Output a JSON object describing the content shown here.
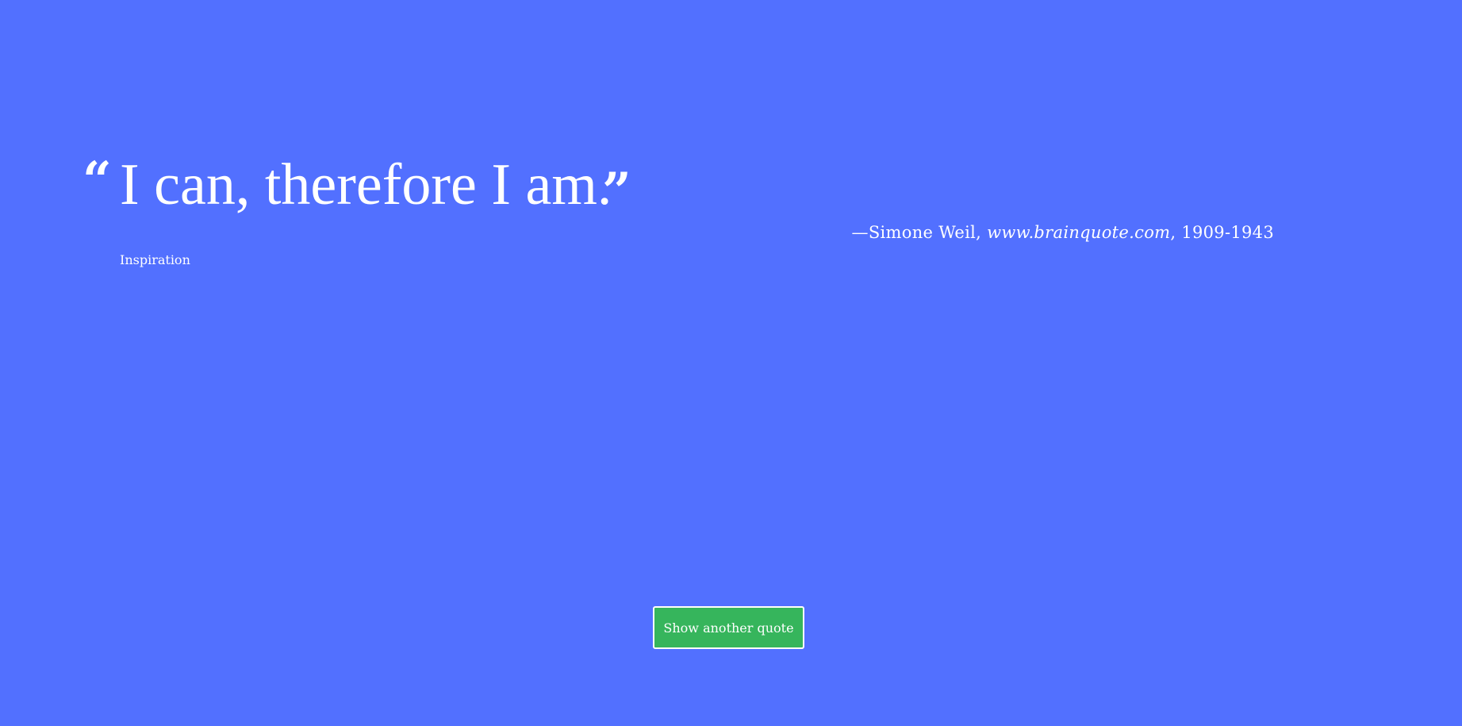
{
  "colors": {
    "background": "#5270ff",
    "text": "#ffffff",
    "button_background": "#36b55c",
    "button_border": "#ffffff"
  },
  "quote": {
    "open_mark": "“",
    "text": "I can, therefore I am.",
    "close_mark": "”",
    "attribution": {
      "dash": "—",
      "author": "Simone Weil",
      "separator1": ", ",
      "source": "www.brainquote.com",
      "separator2": ", ",
      "years": "1909-1943"
    },
    "category": "Inspiration"
  },
  "actions": {
    "new_quote_label": "Show another quote"
  }
}
